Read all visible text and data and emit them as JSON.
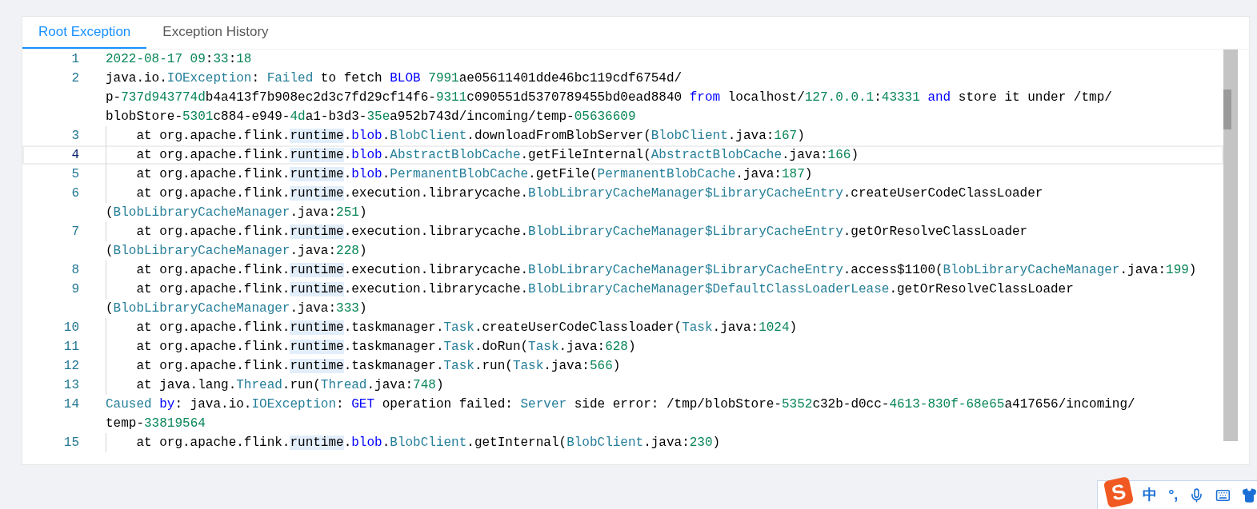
{
  "tabs": [
    {
      "label": "Root Exception",
      "selected": true
    },
    {
      "label": "Exception History",
      "selected": false
    }
  ],
  "editor": {
    "lines": [
      {
        "number": "1",
        "current": false,
        "rows": [
          {
            "segments": [
              {
                "text": "2022-08-17 09",
                "kind": "number"
              },
              {
                "text": ":",
                "kind": "plain"
              },
              {
                "text": "33",
                "kind": "number"
              },
              {
                "text": ":",
                "kind": "plain"
              },
              {
                "text": "18",
                "kind": "number"
              }
            ]
          }
        ]
      },
      {
        "number": "2",
        "current": false,
        "rows": [
          {
            "segments": [
              {
                "text": "java.io.",
                "kind": "plain"
              },
              {
                "text": "IOException",
                "kind": "type"
              },
              {
                "text": ": ",
                "kind": "plain"
              },
              {
                "text": "Failed",
                "kind": "type"
              },
              {
                "text": " to fetch ",
                "kind": "plain"
              },
              {
                "text": "BLOB ",
                "kind": "keyword"
              },
              {
                "text": "7991",
                "kind": "number"
              },
              {
                "text": "ae05611401dde46bc119cdf6754d/",
                "kind": "plain"
              }
            ]
          },
          {
            "segments": [
              {
                "text": "p-",
                "kind": "plain"
              },
              {
                "text": "737d943774d",
                "kind": "number"
              },
              {
                "text": "b4a413f7b908ec2d3c7fd29cf14f6-",
                "kind": "plain"
              },
              {
                "text": "9311",
                "kind": "number"
              },
              {
                "text": "c090551d5370789455bd0ead8840 ",
                "kind": "plain"
              },
              {
                "text": "from",
                "kind": "keyword"
              },
              {
                "text": " localhost/",
                "kind": "plain"
              },
              {
                "text": "127.0.0.1",
                "kind": "number"
              },
              {
                "text": ":",
                "kind": "plain"
              },
              {
                "text": "43331 ",
                "kind": "number"
              },
              {
                "text": "and",
                "kind": "keyword"
              },
              {
                "text": " store it under /tmp/",
                "kind": "plain"
              }
            ]
          },
          {
            "segments": [
              {
                "text": "blobStore-",
                "kind": "plain"
              },
              {
                "text": "5301",
                "kind": "number"
              },
              {
                "text": "c884-e949-",
                "kind": "plain"
              },
              {
                "text": "4d",
                "kind": "number"
              },
              {
                "text": "a1-b3d3-",
                "kind": "plain"
              },
              {
                "text": "35e",
                "kind": "number"
              },
              {
                "text": "a952b743d/incoming/temp-",
                "kind": "plain"
              },
              {
                "text": "05636609",
                "kind": "number"
              }
            ]
          }
        ]
      },
      {
        "number": "3",
        "current": false,
        "rows": [
          {
            "segments": [
              {
                "text": "    at org.apache.flink.",
                "kind": "plain"
              },
              {
                "text": "runtime",
                "kind": "match"
              },
              {
                "text": ".",
                "kind": "plain"
              },
              {
                "text": "blob",
                "kind": "keyword"
              },
              {
                "text": ".",
                "kind": "plain"
              },
              {
                "text": "BlobClient",
                "kind": "type"
              },
              {
                "text": ".downloadFromBlobServer(",
                "kind": "plain"
              },
              {
                "text": "BlobClient",
                "kind": "type"
              },
              {
                "text": ".java:",
                "kind": "plain"
              },
              {
                "text": "167",
                "kind": "number"
              },
              {
                "text": ")",
                "kind": "plain"
              }
            ]
          }
        ]
      },
      {
        "number": "4",
        "current": true,
        "rows": [
          {
            "segments": [
              {
                "text": "    at org.apache.flink.",
                "kind": "plain"
              },
              {
                "text": "runtime",
                "kind": "match"
              },
              {
                "text": ".",
                "kind": "plain"
              },
              {
                "text": "blob",
                "kind": "keyword"
              },
              {
                "text": ".",
                "kind": "plain"
              },
              {
                "text": "AbstractBlobCache",
                "kind": "type"
              },
              {
                "text": ".getFileInternal(",
                "kind": "plain"
              },
              {
                "text": "AbstractBlobCache",
                "kind": "type"
              },
              {
                "text": ".java:",
                "kind": "plain"
              },
              {
                "text": "166",
                "kind": "number"
              },
              {
                "text": ")",
                "kind": "plain"
              }
            ]
          }
        ]
      },
      {
        "number": "5",
        "current": false,
        "rows": [
          {
            "segments": [
              {
                "text": "    at org.apache.flink.",
                "kind": "plain"
              },
              {
                "text": "runtime",
                "kind": "match"
              },
              {
                "text": ".",
                "kind": "plain"
              },
              {
                "text": "blob",
                "kind": "keyword"
              },
              {
                "text": ".",
                "kind": "plain"
              },
              {
                "text": "PermanentBlobCache",
                "kind": "type"
              },
              {
                "text": ".getFile(",
                "kind": "plain"
              },
              {
                "text": "PermanentBlobCache",
                "kind": "type"
              },
              {
                "text": ".java:",
                "kind": "plain"
              },
              {
                "text": "187",
                "kind": "number"
              },
              {
                "text": ")",
                "kind": "plain"
              }
            ]
          }
        ]
      },
      {
        "number": "6",
        "current": false,
        "rows": [
          {
            "segments": [
              {
                "text": "    at org.apache.flink.",
                "kind": "plain"
              },
              {
                "text": "runtime",
                "kind": "match"
              },
              {
                "text": ".execution.librarycache.",
                "kind": "plain"
              },
              {
                "text": "BlobLibraryCacheManager$LibraryCacheEntry",
                "kind": "type"
              },
              {
                "text": ".createUserCodeClassLoader",
                "kind": "plain"
              }
            ]
          },
          {
            "segments": [
              {
                "text": "(",
                "kind": "plain"
              },
              {
                "text": "BlobLibraryCacheManager",
                "kind": "type"
              },
              {
                "text": ".java:",
                "kind": "plain"
              },
              {
                "text": "251",
                "kind": "number"
              },
              {
                "text": ")",
                "kind": "plain"
              }
            ]
          }
        ]
      },
      {
        "number": "7",
        "current": false,
        "rows": [
          {
            "segments": [
              {
                "text": "    at org.apache.flink.",
                "kind": "plain"
              },
              {
                "text": "runtime",
                "kind": "match"
              },
              {
                "text": ".execution.librarycache.",
                "kind": "plain"
              },
              {
                "text": "BlobLibraryCacheManager$LibraryCacheEntry",
                "kind": "type"
              },
              {
                "text": ".getOrResolveClassLoader",
                "kind": "plain"
              }
            ]
          },
          {
            "segments": [
              {
                "text": "(",
                "kind": "plain"
              },
              {
                "text": "BlobLibraryCacheManager",
                "kind": "type"
              },
              {
                "text": ".java:",
                "kind": "plain"
              },
              {
                "text": "228",
                "kind": "number"
              },
              {
                "text": ")",
                "kind": "plain"
              }
            ]
          }
        ]
      },
      {
        "number": "8",
        "current": false,
        "rows": [
          {
            "segments": [
              {
                "text": "    at org.apache.flink.",
                "kind": "plain"
              },
              {
                "text": "runtime",
                "kind": "match"
              },
              {
                "text": ".execution.librarycache.",
                "kind": "plain"
              },
              {
                "text": "BlobLibraryCacheManager$LibraryCacheEntry",
                "kind": "type"
              },
              {
                "text": ".access$1100(",
                "kind": "plain"
              },
              {
                "text": "BlobLibraryCacheManager",
                "kind": "type"
              },
              {
                "text": ".java:",
                "kind": "plain"
              },
              {
                "text": "199",
                "kind": "number"
              },
              {
                "text": ")",
                "kind": "plain"
              }
            ]
          }
        ]
      },
      {
        "number": "9",
        "current": false,
        "rows": [
          {
            "segments": [
              {
                "text": "    at org.apache.flink.",
                "kind": "plain"
              },
              {
                "text": "runtime",
                "kind": "match"
              },
              {
                "text": ".execution.librarycache.",
                "kind": "plain"
              },
              {
                "text": "BlobLibraryCacheManager$DefaultClassLoaderLease",
                "kind": "type"
              },
              {
                "text": ".getOrResolveClassLoader",
                "kind": "plain"
              }
            ]
          },
          {
            "segments": [
              {
                "text": "(",
                "kind": "plain"
              },
              {
                "text": "BlobLibraryCacheManager",
                "kind": "type"
              },
              {
                "text": ".java:",
                "kind": "plain"
              },
              {
                "text": "333",
                "kind": "number"
              },
              {
                "text": ")",
                "kind": "plain"
              }
            ]
          }
        ]
      },
      {
        "number": "10",
        "current": false,
        "rows": [
          {
            "segments": [
              {
                "text": "    at org.apache.flink.",
                "kind": "plain"
              },
              {
                "text": "runtime",
                "kind": "match"
              },
              {
                "text": ".taskmanager.",
                "kind": "plain"
              },
              {
                "text": "Task",
                "kind": "type"
              },
              {
                "text": ".createUserCodeClassloader(",
                "kind": "plain"
              },
              {
                "text": "Task",
                "kind": "type"
              },
              {
                "text": ".java:",
                "kind": "plain"
              },
              {
                "text": "1024",
                "kind": "number"
              },
              {
                "text": ")",
                "kind": "plain"
              }
            ]
          }
        ]
      },
      {
        "number": "11",
        "current": false,
        "rows": [
          {
            "segments": [
              {
                "text": "    at org.apache.flink.",
                "kind": "plain"
              },
              {
                "text": "runtime",
                "kind": "match"
              },
              {
                "text": ".taskmanager.",
                "kind": "plain"
              },
              {
                "text": "Task",
                "kind": "type"
              },
              {
                "text": ".doRun(",
                "kind": "plain"
              },
              {
                "text": "Task",
                "kind": "type"
              },
              {
                "text": ".java:",
                "kind": "plain"
              },
              {
                "text": "628",
                "kind": "number"
              },
              {
                "text": ")",
                "kind": "plain"
              }
            ]
          }
        ]
      },
      {
        "number": "12",
        "current": false,
        "rows": [
          {
            "segments": [
              {
                "text": "    at org.apache.flink.",
                "kind": "plain"
              },
              {
                "text": "runtime",
                "kind": "match"
              },
              {
                "text": ".taskmanager.",
                "kind": "plain"
              },
              {
                "text": "Task",
                "kind": "type"
              },
              {
                "text": ".run(",
                "kind": "plain"
              },
              {
                "text": "Task",
                "kind": "type"
              },
              {
                "text": ".java:",
                "kind": "plain"
              },
              {
                "text": "566",
                "kind": "number"
              },
              {
                "text": ")",
                "kind": "plain"
              }
            ]
          }
        ]
      },
      {
        "number": "13",
        "current": false,
        "rows": [
          {
            "segments": [
              {
                "text": "    at java.lang.",
                "kind": "plain"
              },
              {
                "text": "Thread",
                "kind": "type"
              },
              {
                "text": ".run(",
                "kind": "plain"
              },
              {
                "text": "Thread",
                "kind": "type"
              },
              {
                "text": ".java:",
                "kind": "plain"
              },
              {
                "text": "748",
                "kind": "number"
              },
              {
                "text": ")",
                "kind": "plain"
              }
            ]
          }
        ]
      },
      {
        "number": "14",
        "current": false,
        "rows": [
          {
            "segments": [
              {
                "text": "Caused ",
                "kind": "type"
              },
              {
                "text": "by",
                "kind": "keyword"
              },
              {
                "text": ": java.io.",
                "kind": "plain"
              },
              {
                "text": "IOException",
                "kind": "type"
              },
              {
                "text": ": ",
                "kind": "plain"
              },
              {
                "text": "GET",
                "kind": "keyword"
              },
              {
                "text": " operation failed: ",
                "kind": "plain"
              },
              {
                "text": "Server",
                "kind": "type"
              },
              {
                "text": " side error: /tmp/blobStore-",
                "kind": "plain"
              },
              {
                "text": "5352",
                "kind": "number"
              },
              {
                "text": "c32b-d0cc-",
                "kind": "plain"
              },
              {
                "text": "4613-830f-68e65",
                "kind": "number"
              },
              {
                "text": "a417656/incoming/",
                "kind": "plain"
              }
            ]
          },
          {
            "segments": [
              {
                "text": "temp-",
                "kind": "plain"
              },
              {
                "text": "33819564",
                "kind": "number"
              }
            ]
          }
        ]
      },
      {
        "number": "15",
        "current": false,
        "rows": [
          {
            "segments": [
              {
                "text": "    at org.apache.flink.",
                "kind": "plain"
              },
              {
                "text": "runtime",
                "kind": "match"
              },
              {
                "text": ".",
                "kind": "plain"
              },
              {
                "text": "blob",
                "kind": "keyword"
              },
              {
                "text": ".",
                "kind": "plain"
              },
              {
                "text": "BlobClient",
                "kind": "type"
              },
              {
                "text": ".getInternal(",
                "kind": "plain"
              },
              {
                "text": "BlobClient",
                "kind": "type"
              },
              {
                "text": ".java:",
                "kind": "plain"
              },
              {
                "text": "230",
                "kind": "number"
              },
              {
                "text": ")",
                "kind": "plain"
              }
            ]
          }
        ]
      }
    ]
  },
  "ime_toolbar": {
    "logo": "S",
    "items": [
      "中",
      "°,"
    ]
  }
}
